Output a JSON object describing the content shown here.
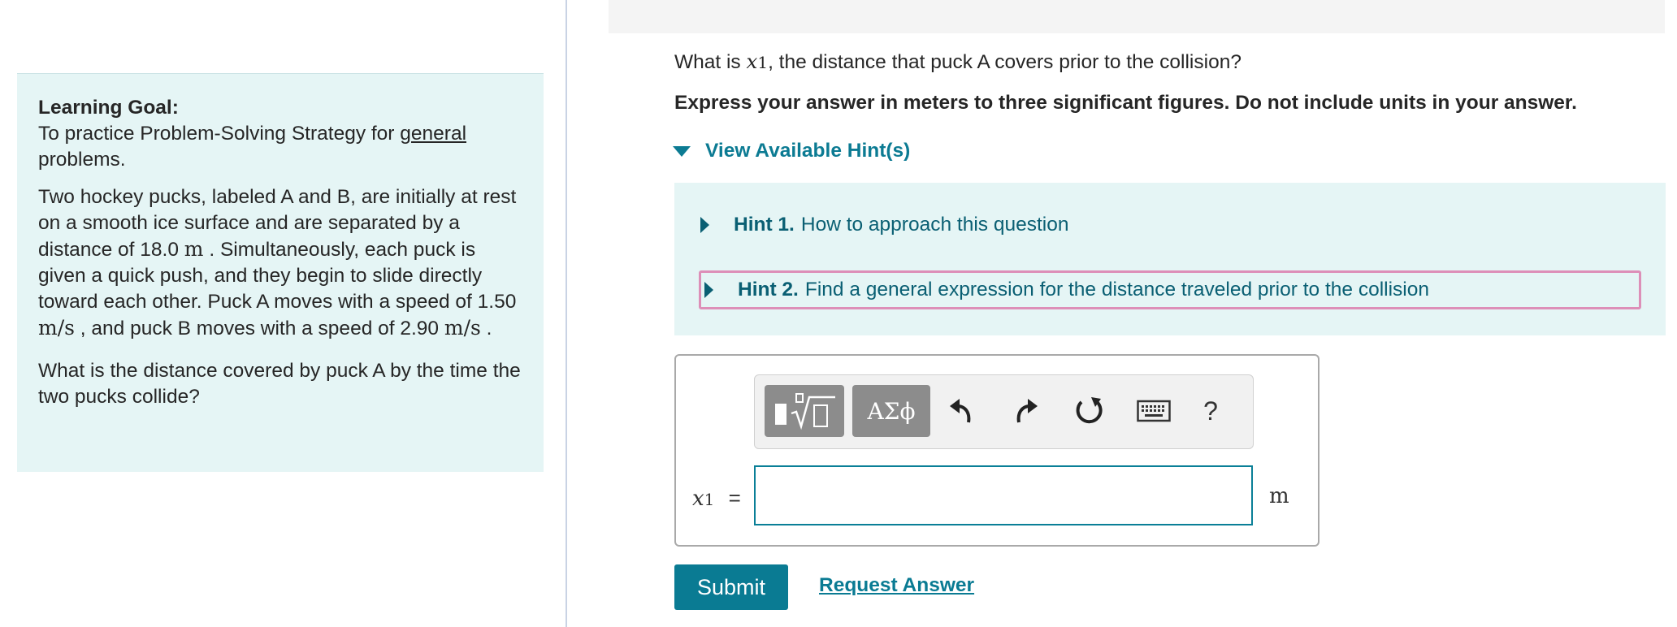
{
  "learning_goal": {
    "heading": "Learning Goal:",
    "text_before_link": "To practice Problem-Solving Strategy for ",
    "link_text": "general",
    "text_after_link": " problems."
  },
  "problem": {
    "p1": "Two hockey pucks, labeled A and B, are initially at rest on a smooth ice surface and are separated by a distance of 18.0",
    "u_m": "m",
    "p2": ". Simultaneously, each puck is given a quick push, and they begin to slide directly toward each other. Puck A moves with a speed of 1.50",
    "u_ms": "m/s",
    "p3": ", and puck B moves with a speed of 2.90",
    "p4": "."
  },
  "question_panel_question": "What is the distance covered by puck A by the time the two pucks collide?",
  "question": {
    "before": "What is ",
    "var": "x",
    "sub": "1",
    "after": ", the distance that puck A covers prior to the collision?"
  },
  "instruction": "Express your answer in meters to three significant figures. Do not include units in your answer.",
  "hints": {
    "toggle_label": "View Available Hint(s)",
    "items": [
      {
        "label": "Hint 1.",
        "text": "How to approach this question"
      },
      {
        "label": "Hint 2.",
        "text": "Find a general expression for the distance traveled prior to the collision"
      }
    ]
  },
  "toolbar": {
    "symbols_label": "ΑΣϕ",
    "help_label": "?",
    "icons": [
      "template-icon",
      "undo-icon",
      "redo-icon",
      "reset-icon",
      "keyboard-icon"
    ]
  },
  "answer": {
    "var": "x",
    "sub": "1",
    "equals": "=",
    "value": "",
    "unit": "m"
  },
  "actions": {
    "submit": "Submit",
    "request": "Request Answer"
  },
  "colors": {
    "accent": "#0a7b93",
    "panel_bg": "#e5f5f5",
    "hint_highlight": "#dd8fb8"
  }
}
